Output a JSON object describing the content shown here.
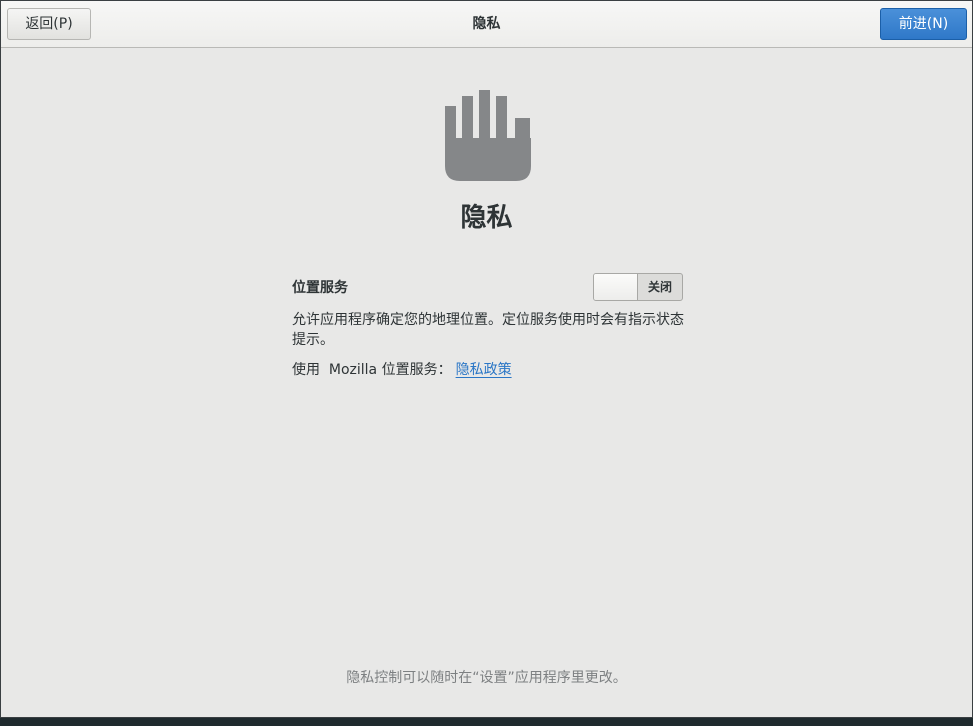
{
  "header": {
    "title": "隐私",
    "back_label": "返回(P)",
    "next_label": "前进(N)"
  },
  "main": {
    "icon": "hand-stop-icon",
    "title": "隐私",
    "location_label": "位置服务",
    "toggle_state_label": "关闭",
    "description": "允许应用程序确定您的地理位置。定位服务使用时会有指示状态提示。",
    "mozilla_prefix": "使用  Mozilla 位置服务：",
    "privacy_policy_link": "隐私政策"
  },
  "footer": {
    "note": "隐私控制可以随时在“设置”应用程序里更改。"
  },
  "colors": {
    "accent": "#2f78c8",
    "link": "#2a76c6",
    "icon": "#858789",
    "background": "#e8e8e7"
  }
}
